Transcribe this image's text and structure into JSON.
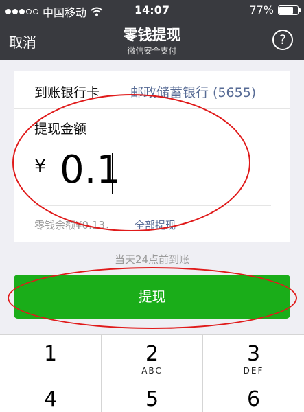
{
  "status_bar": {
    "carrier": "中国移动",
    "time": "14:07",
    "battery": "77%",
    "battery_level": 0.77
  },
  "nav": {
    "cancel_label": "取消",
    "title": "零钱提现",
    "subtitle": "微信安全支付",
    "help_label": "?"
  },
  "form": {
    "bank_label": "到账银行卡",
    "bank_name": "邮政储蓄银行 (5655)",
    "amount_label": "提现金额",
    "currency_symbol": "¥",
    "amount_value": "0.1",
    "balance_text": "零钱余额¥0.13，",
    "withdraw_all_label": "全部提现"
  },
  "arrival_note": "当天24点前到账",
  "submit_label": "提现",
  "keypad": {
    "keys": [
      {
        "num": "1",
        "letters": ""
      },
      {
        "num": "2",
        "letters": "ABC"
      },
      {
        "num": "3",
        "letters": "DEF"
      },
      {
        "num": "4",
        "letters": ""
      },
      {
        "num": "5",
        "letters": ""
      },
      {
        "num": "6",
        "letters": ""
      }
    ]
  },
  "annotation_color": "#e01a1a"
}
